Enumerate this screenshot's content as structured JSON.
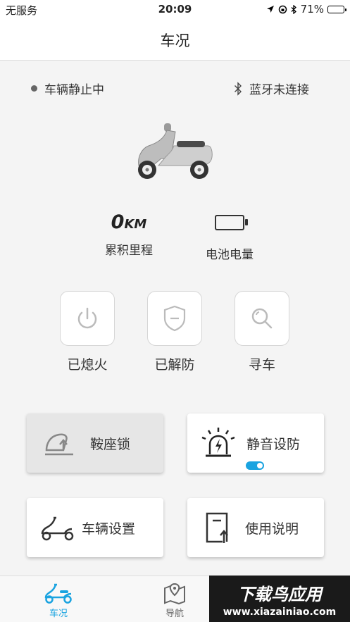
{
  "status_bar": {
    "carrier": "无服务",
    "time": "20:09",
    "battery_percent": "71%",
    "battery_level": 0.71
  },
  "nav": {
    "title": "车况"
  },
  "vehicle": {
    "motion_status": "车辆静止中",
    "bluetooth_status": "蓝牙未连接"
  },
  "stats": {
    "mileage_value": "0",
    "mileage_unit": "KM",
    "mileage_label": "累积里程",
    "battery_label": "电池电量"
  },
  "controls": [
    {
      "label": "已熄火",
      "icon": "power-icon"
    },
    {
      "label": "已解防",
      "icon": "shield-icon"
    },
    {
      "label": "寻车",
      "icon": "search-icon"
    }
  ],
  "cards": {
    "seat_lock": {
      "label": "鞍座锁",
      "icon": "seat-lock-icon"
    },
    "silent_arm": {
      "label": "静音设防",
      "icon": "alarm-icon",
      "toggle_on": true
    },
    "vehicle_settings": {
      "label": "车辆设置",
      "icon": "scooter-outline-icon"
    },
    "manual": {
      "label": "使用说明",
      "icon": "manual-icon"
    }
  },
  "tabs": [
    {
      "label": "车况",
      "icon": "scooter-tab-icon",
      "active": true
    },
    {
      "label": "导航",
      "icon": "map-pin-icon",
      "active": false
    }
  ],
  "watermark": {
    "title": "下载鸟应用",
    "url": "www.xiazainiao.com"
  },
  "colors": {
    "accent": "#1aa3e0",
    "card_bg": "#ffffff",
    "page_bg": "#f4f4f4"
  }
}
